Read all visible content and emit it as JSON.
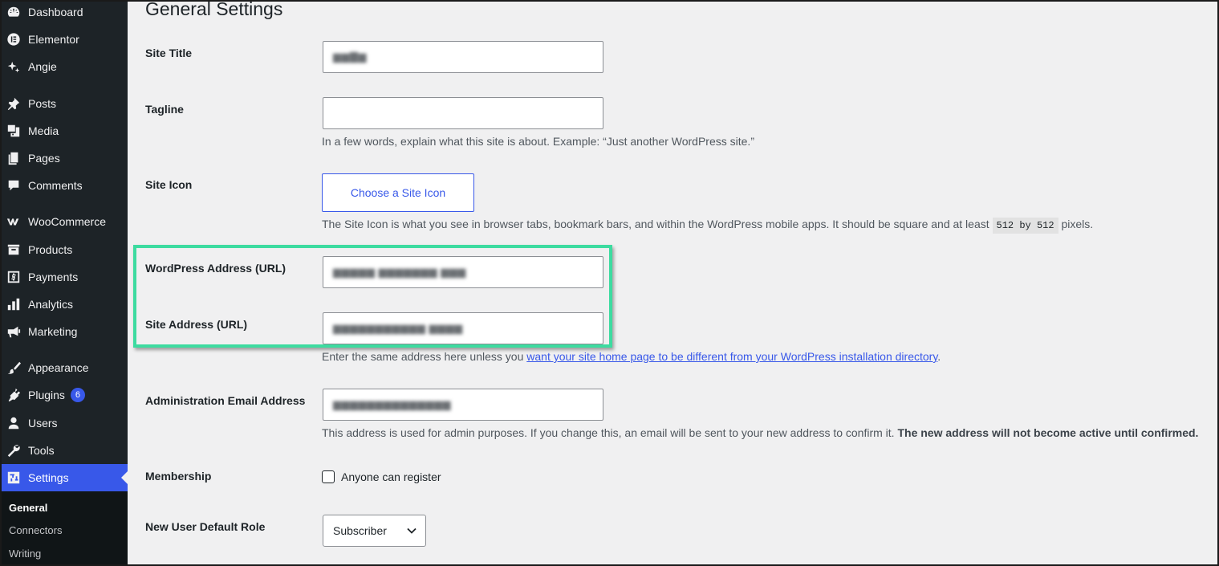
{
  "sidebar": {
    "items": [
      {
        "label": "Dashboard",
        "icon": "dashboard-icon"
      },
      {
        "label": "Elementor",
        "icon": "elementor-icon"
      },
      {
        "label": "Angie",
        "icon": "sparkle-icon"
      },
      {
        "label": "Posts",
        "icon": "pin-icon"
      },
      {
        "label": "Media",
        "icon": "media-icon"
      },
      {
        "label": "Pages",
        "icon": "pages-icon"
      },
      {
        "label": "Comments",
        "icon": "comment-icon"
      },
      {
        "label": "WooCommerce",
        "icon": "woocommerce-icon"
      },
      {
        "label": "Products",
        "icon": "archive-icon"
      },
      {
        "label": "Payments",
        "icon": "dollar-icon"
      },
      {
        "label": "Analytics",
        "icon": "bar-chart-icon"
      },
      {
        "label": "Marketing",
        "icon": "megaphone-icon"
      },
      {
        "label": "Appearance",
        "icon": "paintbrush-icon"
      },
      {
        "label": "Plugins",
        "icon": "plugin-icon",
        "badge": "6"
      },
      {
        "label": "Users",
        "icon": "user-icon"
      },
      {
        "label": "Tools",
        "icon": "wrench-icon"
      },
      {
        "label": "Settings",
        "icon": "settings-icon",
        "current": true
      }
    ],
    "submenu": [
      "General",
      "Connectors",
      "Writing"
    ]
  },
  "page": {
    "title": "General Settings"
  },
  "fields": {
    "site_title": {
      "label": "Site Title"
    },
    "tagline": {
      "label": "Tagline",
      "value": "",
      "description": "In a few words, explain what this site is about. Example: “Just another WordPress site.”"
    },
    "site_icon": {
      "label": "Site Icon",
      "button": "Choose a Site Icon",
      "description_before": "The Site Icon is what you see in browser tabs, bookmark bars, and within the WordPress mobile apps. It should be square and at least",
      "code": "512 by 512",
      "description_after": "pixels."
    },
    "wp_address": {
      "label": "WordPress Address (URL)"
    },
    "site_address": {
      "label": "Site Address (URL)",
      "description_before": "Enter the same address here unless you",
      "link": "want your site home page to be different from your WordPress installation directory",
      "description_after": "."
    },
    "admin_email": {
      "label": "Administration Email Address",
      "description": "This address is used for admin purposes. If you change this, an email will be sent to your new address to confirm it.",
      "description_bold": "The new address will not become active until confirmed."
    },
    "membership": {
      "label": "Membership",
      "checkbox_label": "Anyone can register",
      "checked": false
    },
    "default_role": {
      "label": "New User Default Role",
      "value": "Subscriber"
    }
  },
  "colors": {
    "accent": "#3858e9",
    "highlight": "#3ddba0",
    "sidebar": "#1d2327"
  }
}
